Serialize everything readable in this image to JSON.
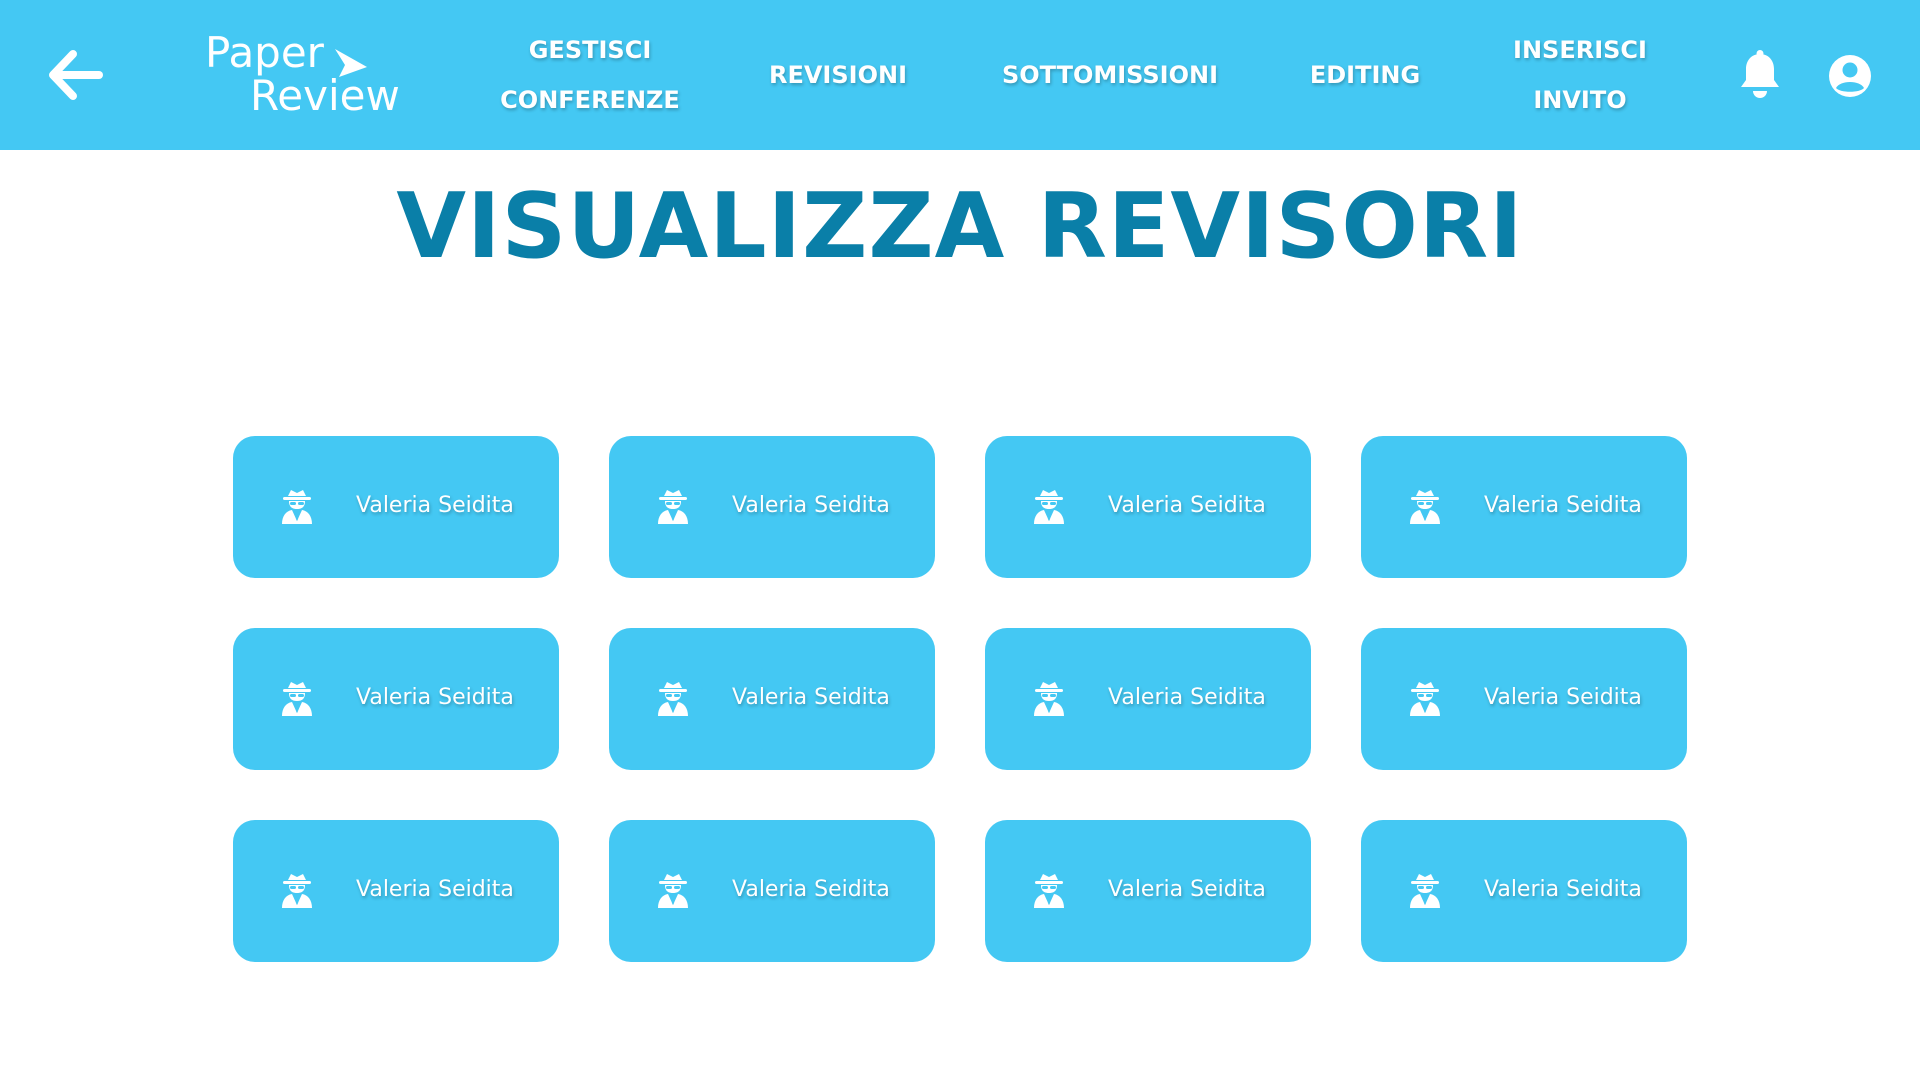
{
  "header": {
    "back_icon": "arrow-left-icon",
    "logo": {
      "line1": "Paper",
      "line2": "Review",
      "icon": "paper-plane-icon"
    },
    "nav": [
      {
        "line1": "GESTISCI",
        "line2": "CONFERENZE"
      },
      {
        "line1": "REVISIONI"
      },
      {
        "line1": "SOTTOMISSIONI"
      },
      {
        "line1": "EDITING"
      },
      {
        "line1": "INSERISCI",
        "line2": "INVITO"
      }
    ],
    "bell_icon": "bell-icon",
    "user_icon": "user-circle-icon"
  },
  "main": {
    "title": "VISUALIZZA REVISORI",
    "reviewers": [
      {
        "name": "Valeria Seidita",
        "icon": "user-secret-icon"
      },
      {
        "name": "Valeria Seidita",
        "icon": "user-secret-icon"
      },
      {
        "name": "Valeria Seidita",
        "icon": "user-secret-icon"
      },
      {
        "name": "Valeria Seidita",
        "icon": "user-secret-icon"
      },
      {
        "name": "Valeria Seidita",
        "icon": "user-secret-icon"
      },
      {
        "name": "Valeria Seidita",
        "icon": "user-secret-icon"
      },
      {
        "name": "Valeria Seidita",
        "icon": "user-secret-icon"
      },
      {
        "name": "Valeria Seidita",
        "icon": "user-secret-icon"
      },
      {
        "name": "Valeria Seidita",
        "icon": "user-secret-icon"
      },
      {
        "name": "Valeria Seidita",
        "icon": "user-secret-icon"
      },
      {
        "name": "Valeria Seidita",
        "icon": "user-secret-icon"
      },
      {
        "name": "Valeria Seidita",
        "icon": "user-secret-icon"
      }
    ]
  },
  "colors": {
    "accent": "#44c8f3",
    "title": "#0a7fa8",
    "background": "#ffffff",
    "text_on_accent": "#ffffff"
  }
}
